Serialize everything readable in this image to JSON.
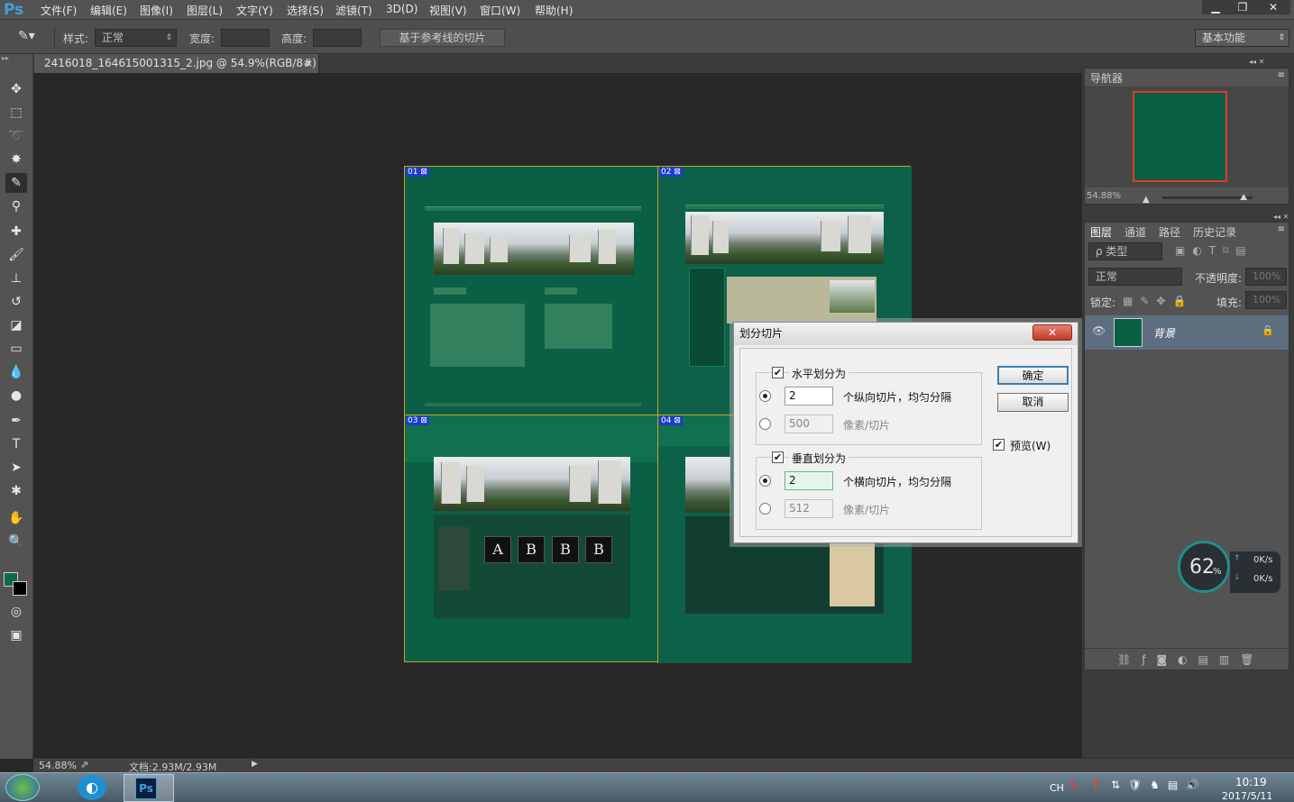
{
  "app": {
    "logo": "Ps",
    "menus": [
      "文件(F)",
      "编辑(E)",
      "图像(I)",
      "图层(L)",
      "文字(Y)",
      "选择(S)",
      "滤镜(T)",
      "3D(D)",
      "视图(V)",
      "窗口(W)",
      "帮助(H)"
    ],
    "window_controls": [
      "minimize-icon",
      "restore-icon",
      "close-icon"
    ]
  },
  "options": {
    "style_label": "样式:",
    "style_value": "正常",
    "width_label": "宽度:",
    "height_label": "高度:",
    "guides_button": "基于参考线的切片",
    "workspace": "基本功能"
  },
  "document": {
    "tab_title": "2416018_164615001315_2.jpg @ 54.9%(RGB/8#) *",
    "slice_labels": [
      "01",
      "02",
      "03",
      "04"
    ],
    "colors": {
      "background": "#0b5f44",
      "slice_border": "#c9a227",
      "slice_label": "#1e3bd0"
    }
  },
  "status": {
    "zoom": "54.88%",
    "doc_size": "文档:2.93M/2.93M"
  },
  "navigator": {
    "tab": "导航器",
    "zoom": "54.88%"
  },
  "layers": {
    "tabs": [
      "图层",
      "通道",
      "路径",
      "历史记录"
    ],
    "filter_label": "ρ 类型",
    "blend_mode": "正常",
    "opacity_label": "不透明度:",
    "opacity_value": "100%",
    "lock_label": "锁定:",
    "fill_label": "填充:",
    "fill_value": "100%",
    "layer_name": "背景"
  },
  "dialog": {
    "title": "划分切片",
    "horizontal_label": "水平划分为",
    "horizontal_count": "2",
    "horizontal_count_suffix": "个纵向切片，均匀分隔",
    "horizontal_pixels": "500",
    "pixels_suffix": "像素/切片",
    "vertical_label": "垂直划分为",
    "vertical_count": "2",
    "vertical_count_suffix": "个横向切片，均匀分隔",
    "vertical_pixels": "512",
    "ok": "确定",
    "cancel": "取消",
    "preview": "预览(W)"
  },
  "monitor": {
    "percent": "62",
    "percent_unit": "%",
    "up": "0K/s",
    "down": "0K/s"
  },
  "taskbar": {
    "lang": "CH",
    "time": "10:19",
    "date": "2017/5/11"
  }
}
